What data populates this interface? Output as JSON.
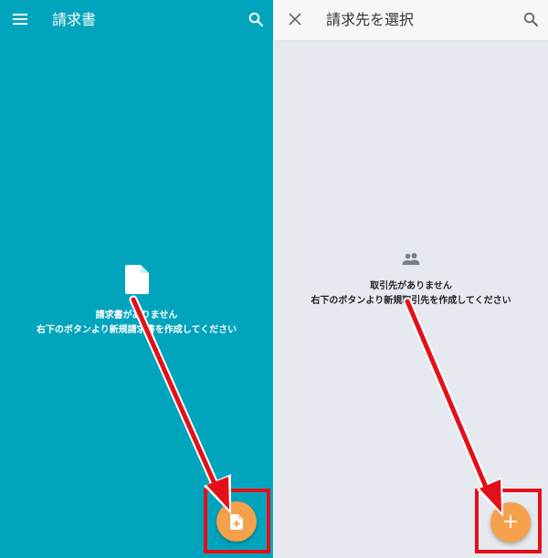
{
  "invoice_screen": {
    "title": "請求書",
    "empty_title": "請求書がありません",
    "empty_hint": "右下のボタンより新規請求書を作成してください"
  },
  "client_screen": {
    "title": "請求先を選択",
    "empty_title": "取引先がありません",
    "empty_hint": "右下のボタンより新規取引先を作成してください",
    "add_label": "+"
  },
  "icons": {
    "menu": "hamburger-menu-icon",
    "search": "search-icon",
    "close": "close-icon",
    "document": "document-icon",
    "people": "people-icon",
    "new_invoice": "note-add-icon"
  },
  "colors": {
    "invoice_background": "#00a5bd",
    "client_background": "#e6eaf0",
    "client_appbar": "#f7f7f8",
    "fab": "#f5a04c",
    "highlight": "#e3101a"
  }
}
